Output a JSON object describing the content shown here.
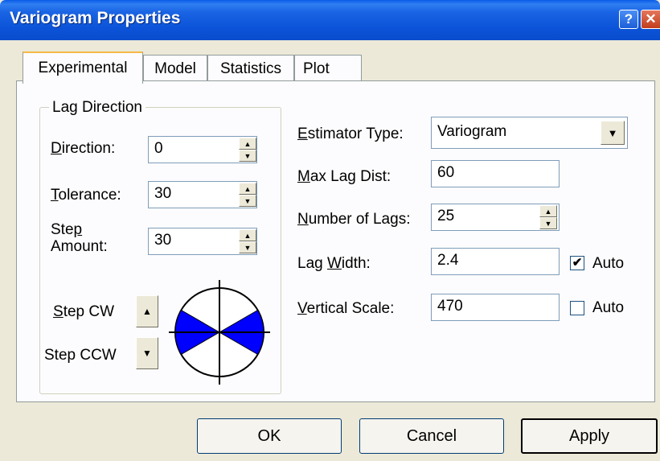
{
  "window": {
    "title": "Variogram Properties",
    "help": "?",
    "close": "✕"
  },
  "tabs": [
    "Experimental",
    "Model",
    "Statistics",
    "Plot"
  ],
  "lag_direction": {
    "group_label": "Lag Direction",
    "direction": {
      "label": "Direction:",
      "value": "0"
    },
    "tolerance": {
      "label": "Tolerance:",
      "value": "30"
    },
    "step_amount": {
      "label_line1": "Step",
      "label_line2": "Amount:",
      "value": "30"
    },
    "step_cw": "Step CW",
    "step_ccw": "Step CCW"
  },
  "estimator": {
    "estimator_type": {
      "label": "Estimator Type:",
      "value": "Variogram"
    },
    "max_lag_dist": {
      "label": "Max Lag Dist:",
      "value": "60"
    },
    "number_of_lags": {
      "label": "Number of Lags:",
      "value": "25"
    },
    "lag_width": {
      "label": "Lag Width:",
      "value": "2.4",
      "auto_label": "Auto",
      "auto_checked": true
    },
    "vertical_scale": {
      "label": "Vertical Scale:",
      "value": "470",
      "auto_label": "Auto",
      "auto_checked": false
    }
  },
  "buttons": {
    "ok": "OK",
    "cancel": "Cancel",
    "apply": "Apply"
  },
  "icons": {
    "spin_up": "▲",
    "spin_down": "▼",
    "dropdown": "▼",
    "check": "✔"
  },
  "colors": {
    "titlebar": "#0a4ccd",
    "sector_fill": "#0000ff",
    "face": "#ece9d8"
  }
}
